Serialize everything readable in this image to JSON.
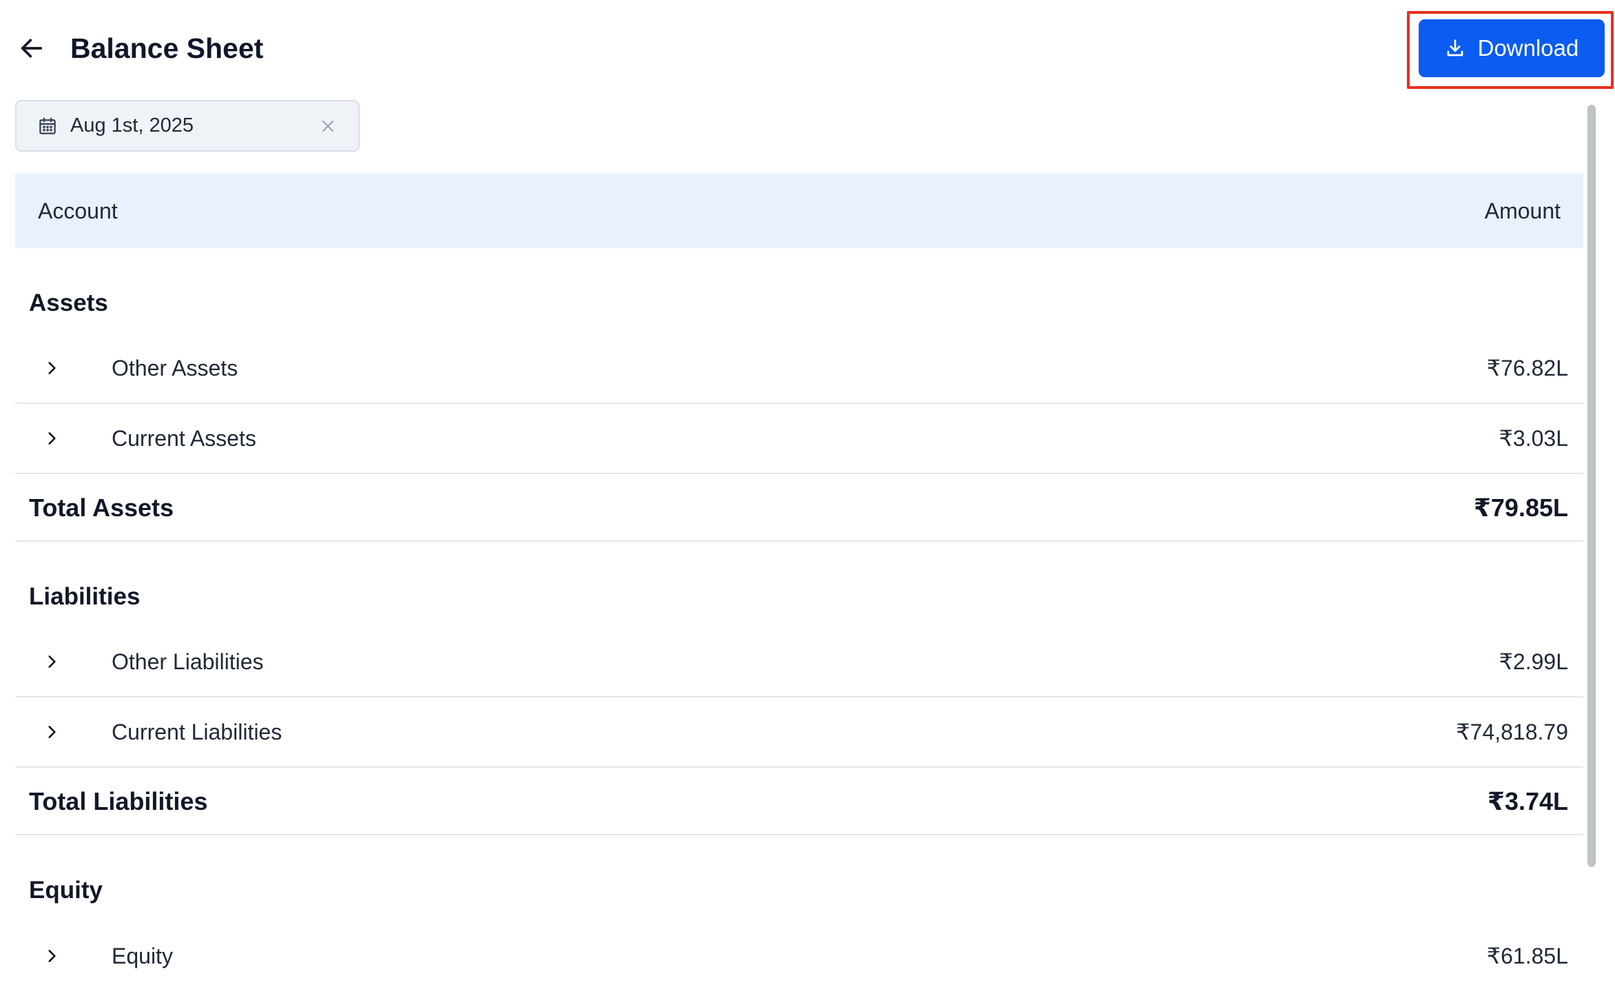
{
  "header": {
    "title": "Balance Sheet",
    "download_label": "Download"
  },
  "date_filter": {
    "value": "Aug 1st, 2025"
  },
  "table": {
    "columns": [
      "Account",
      "Amount"
    ]
  },
  "sections": {
    "assets": {
      "title": "Assets",
      "rows": [
        {
          "label": "Other Assets",
          "amount": "₹76.82L"
        },
        {
          "label": "Current Assets",
          "amount": "₹3.03L"
        }
      ],
      "total_label": "Total Assets",
      "total_amount": "₹79.85L"
    },
    "liabilities": {
      "title": "Liabilities",
      "rows": [
        {
          "label": "Other Liabilities",
          "amount": "₹2.99L"
        },
        {
          "label": "Current Liabilities",
          "amount": "₹74,818.79"
        }
      ],
      "total_label": "Total Liabilities",
      "total_amount": "₹3.74L"
    },
    "equity": {
      "title": "Equity",
      "rows": [
        {
          "label": "Equity",
          "amount": "₹61.85L"
        }
      ]
    }
  },
  "colors": {
    "accent": "#0b5cf0",
    "table_header_bg": "#e8f1fd",
    "highlight": "#e5301c"
  },
  "icons": {
    "back": "arrow-left-icon",
    "download": "download-icon",
    "calendar": "calendar-icon",
    "clear": "close-icon",
    "expand": "chevron-right-icon"
  }
}
